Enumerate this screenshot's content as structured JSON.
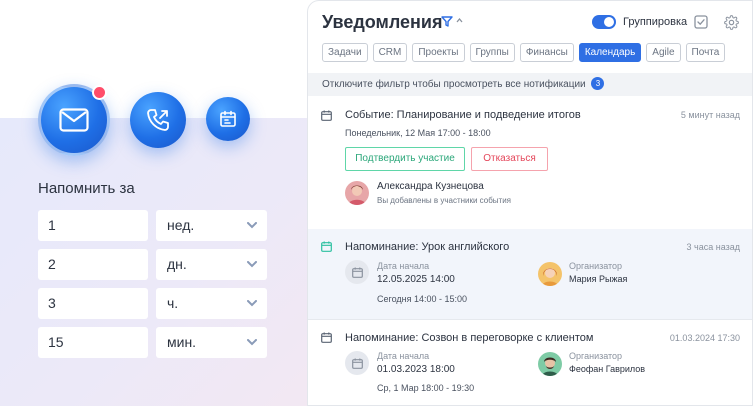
{
  "reminder": {
    "title": "Напомнить за",
    "rows": [
      {
        "value": "1",
        "unit": "нед."
      },
      {
        "value": "2",
        "unit": "дн."
      },
      {
        "value": "3",
        "unit": "ч."
      },
      {
        "value": "15",
        "unit": "мин."
      }
    ]
  },
  "panel": {
    "title": "Уведомления",
    "grouping_label": "Группировка",
    "tabs": [
      "Задачи",
      "CRM",
      "Проекты",
      "Группы",
      "Финансы",
      "Календарь",
      "Agile",
      "Почта"
    ],
    "active_tab": "Календарь",
    "filter_notice": "Отключите фильтр чтобы просмотреть все нотификации",
    "filter_count": "3"
  },
  "notifications": [
    {
      "title": "Событие: Планирование и подведение итогов",
      "time": "5 минут назад",
      "subtitle": "Понедельник, 12 Мая 17:00 - 18:00",
      "accept_label": "Подтвердить участие",
      "decline_label": "Отказаться",
      "person_name": "Александра Кузнецова",
      "person_note": "Вы добавлены в участники события"
    },
    {
      "title": "Напоминание: Урок английского",
      "time": "3 часа назад",
      "start_label": "Дата начала",
      "start_value": "12.05.2025 14:00",
      "schedule": "Сегодня 14:00 - 15:00",
      "organizer_label": "Организатор",
      "organizer_name": "Мария Рыжая"
    },
    {
      "title": "Напоминание: Созвон в переговорке с клиентом",
      "time": "01.03.2024 17:30",
      "start_label": "Дата начала",
      "start_value": "01.03.2023 18:00",
      "schedule": "Ср, 1 Мар 18:00 - 19:30",
      "organizer_label": "Организатор",
      "organizer_name": "Феофан Гаврилов"
    }
  ],
  "colors": {
    "accent": "#2f6fe4",
    "accept": "#2ba77a",
    "decline": "#e4465a",
    "badge": "#ff4d6a"
  }
}
